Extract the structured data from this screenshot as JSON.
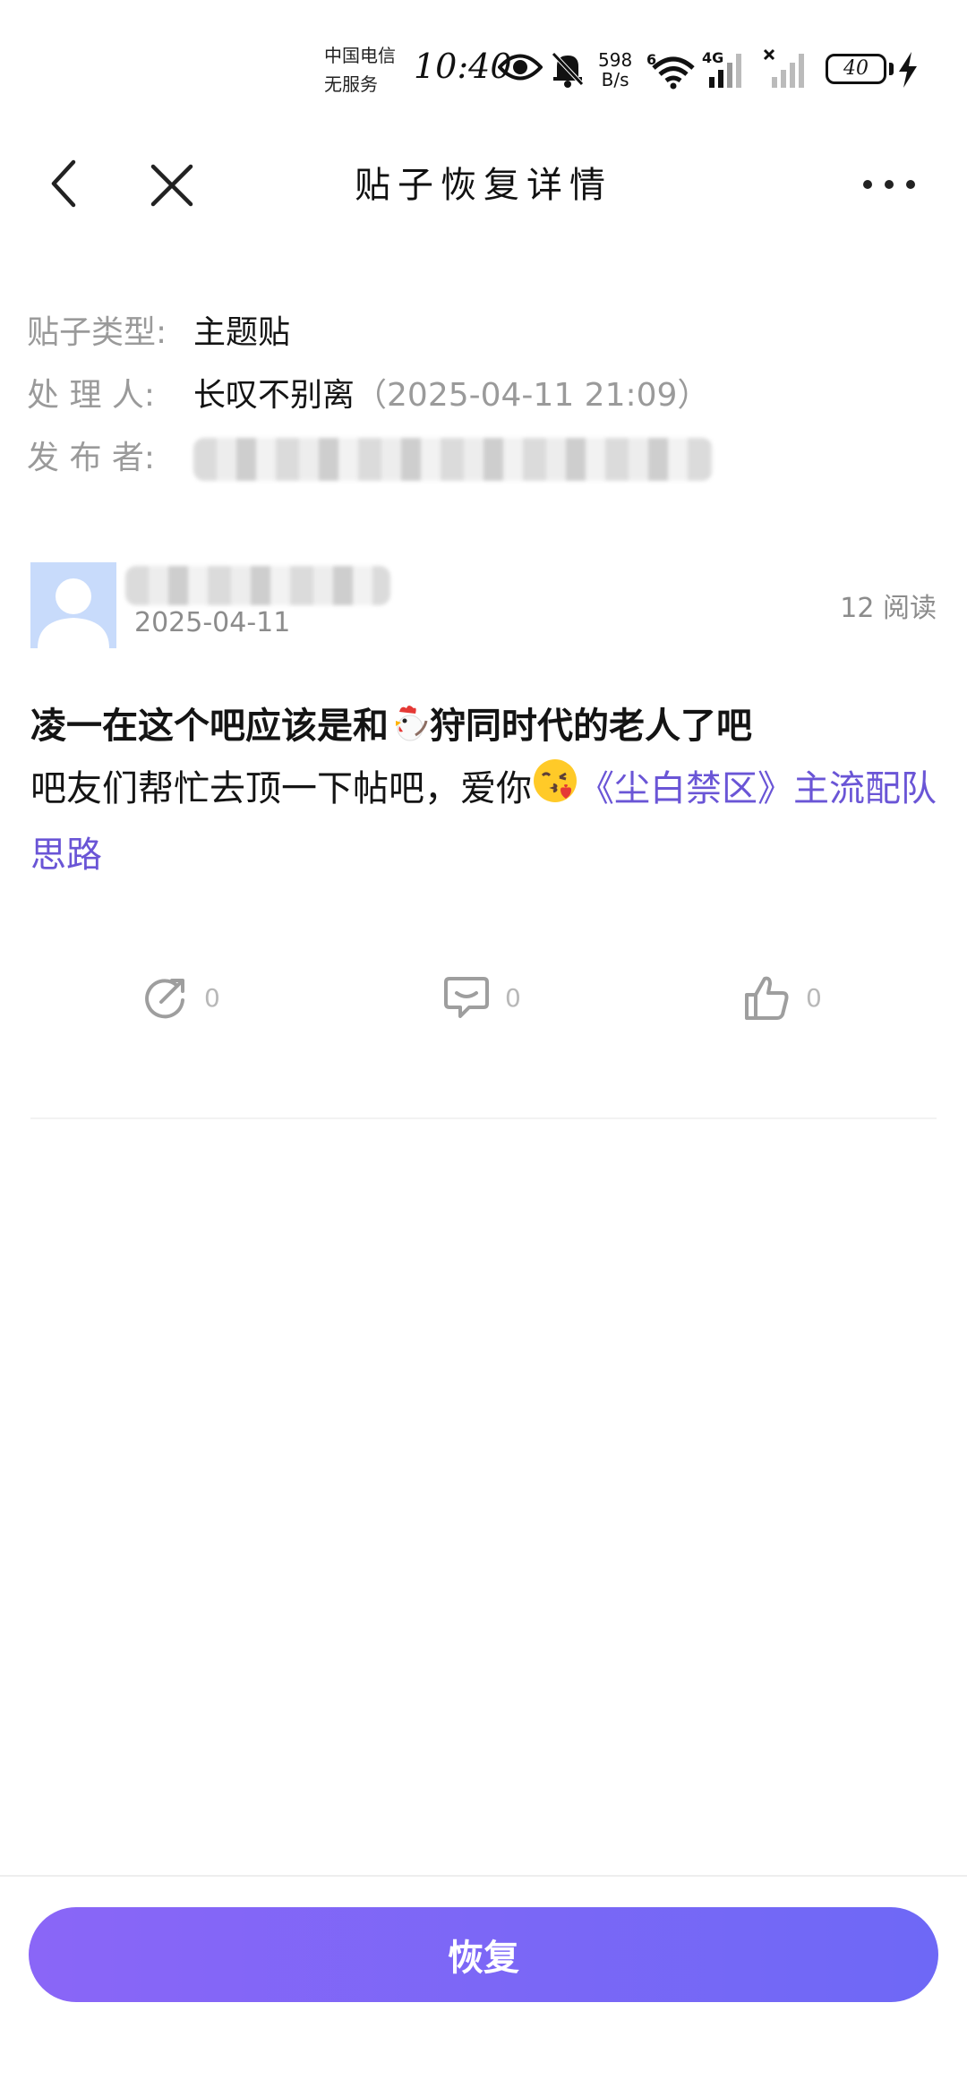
{
  "status_bar": {
    "carrier_line1": "中国电信",
    "carrier_line2": "无服务",
    "time": "10:40",
    "net_speed_value": "598",
    "net_speed_unit": "B/s",
    "wifi_label": "6",
    "signal_label": "4G",
    "battery": "40"
  },
  "header": {
    "title": "贴子恢复详情"
  },
  "meta": {
    "type_label": "贴子类型:",
    "type_value": "主题贴",
    "handler_label": "处 理 人:",
    "handler_name": "长叹不别离",
    "handler_time": "（2025-04-11 21:09）",
    "publisher_label": "发 布 者:"
  },
  "post": {
    "date": "2025-04-11",
    "read_count": "12 阅读",
    "title_part1": "凌一在这个吧应该是和",
    "title_part2": "狩同时代的老人了吧",
    "body_text": "吧友们帮忙去顶一下帖吧，爱你",
    "body_link": "《尘白禁区》主流配队思路"
  },
  "actions": {
    "share_count": "0",
    "comment_count": "0",
    "like_count": "0"
  },
  "footer": {
    "restore_label": "恢复"
  },
  "colors": {
    "accent_start": "#8a66f7",
    "accent_end": "#6e68f6",
    "link": "#6a55d6",
    "label_gray": "#9a9a9a"
  }
}
